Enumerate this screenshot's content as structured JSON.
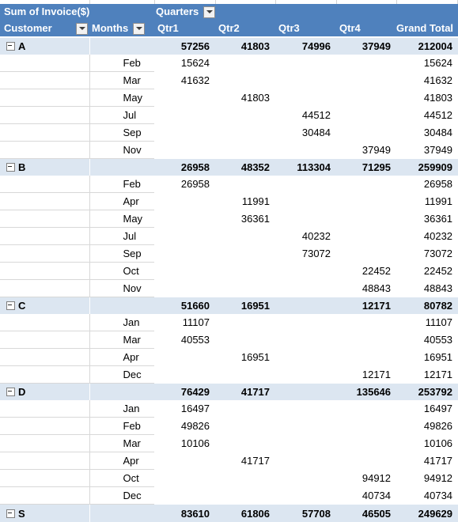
{
  "header": {
    "value_field_label": "Sum of Invoice($)",
    "column_field_label": "Quarters",
    "row_field_customer": "Customer",
    "row_field_months": "Months",
    "columns": [
      "Qtr1",
      "Qtr2",
      "Qtr3",
      "Qtr4",
      "Grand Total"
    ],
    "filter_icon": "chevron-down-icon"
  },
  "colors": {
    "header_blue": "#4f81bd",
    "subtotal_blue": "#dce6f1",
    "body_white": "#ffffff",
    "text_dark": "#000000",
    "header_text": "#ffffff"
  },
  "expand_icon": "minus-box-icon",
  "rows": [
    {
      "type": "subtotal",
      "customer": "A",
      "month": "",
      "qtr1": "57256",
      "qtr2": "41803",
      "qtr3": "74996",
      "qtr4": "37949",
      "total": "212004"
    },
    {
      "type": "data",
      "customer": "",
      "month": "Feb",
      "qtr1": "15624",
      "qtr2": "",
      "qtr3": "",
      "qtr4": "",
      "total": "15624"
    },
    {
      "type": "data",
      "customer": "",
      "month": "Mar",
      "qtr1": "41632",
      "qtr2": "",
      "qtr3": "",
      "qtr4": "",
      "total": "41632"
    },
    {
      "type": "data",
      "customer": "",
      "month": "May",
      "qtr1": "",
      "qtr2": "41803",
      "qtr3": "",
      "qtr4": "",
      "total": "41803"
    },
    {
      "type": "data",
      "customer": "",
      "month": "Jul",
      "qtr1": "",
      "qtr2": "",
      "qtr3": "44512",
      "qtr4": "",
      "total": "44512"
    },
    {
      "type": "data",
      "customer": "",
      "month": "Sep",
      "qtr1": "",
      "qtr2": "",
      "qtr3": "30484",
      "qtr4": "",
      "total": "30484"
    },
    {
      "type": "data",
      "customer": "",
      "month": "Nov",
      "qtr1": "",
      "qtr2": "",
      "qtr3": "",
      "qtr4": "37949",
      "total": "37949"
    },
    {
      "type": "subtotal",
      "customer": "B",
      "month": "",
      "qtr1": "26958",
      "qtr2": "48352",
      "qtr3": "113304",
      "qtr4": "71295",
      "total": "259909"
    },
    {
      "type": "data",
      "customer": "",
      "month": "Feb",
      "qtr1": "26958",
      "qtr2": "",
      "qtr3": "",
      "qtr4": "",
      "total": "26958"
    },
    {
      "type": "data",
      "customer": "",
      "month": "Apr",
      "qtr1": "",
      "qtr2": "11991",
      "qtr3": "",
      "qtr4": "",
      "total": "11991"
    },
    {
      "type": "data",
      "customer": "",
      "month": "May",
      "qtr1": "",
      "qtr2": "36361",
      "qtr3": "",
      "qtr4": "",
      "total": "36361"
    },
    {
      "type": "data",
      "customer": "",
      "month": "Jul",
      "qtr1": "",
      "qtr2": "",
      "qtr3": "40232",
      "qtr4": "",
      "total": "40232"
    },
    {
      "type": "data",
      "customer": "",
      "month": "Sep",
      "qtr1": "",
      "qtr2": "",
      "qtr3": "73072",
      "qtr4": "",
      "total": "73072"
    },
    {
      "type": "data",
      "customer": "",
      "month": "Oct",
      "qtr1": "",
      "qtr2": "",
      "qtr3": "",
      "qtr4": "22452",
      "total": "22452"
    },
    {
      "type": "data",
      "customer": "",
      "month": "Nov",
      "qtr1": "",
      "qtr2": "",
      "qtr3": "",
      "qtr4": "48843",
      "total": "48843"
    },
    {
      "type": "subtotal",
      "customer": "C",
      "month": "",
      "qtr1": "51660",
      "qtr2": "16951",
      "qtr3": "",
      "qtr4": "12171",
      "total": "80782"
    },
    {
      "type": "data",
      "customer": "",
      "month": "Jan",
      "qtr1": "11107",
      "qtr2": "",
      "qtr3": "",
      "qtr4": "",
      "total": "11107"
    },
    {
      "type": "data",
      "customer": "",
      "month": "Mar",
      "qtr1": "40553",
      "qtr2": "",
      "qtr3": "",
      "qtr4": "",
      "total": "40553"
    },
    {
      "type": "data",
      "customer": "",
      "month": "Apr",
      "qtr1": "",
      "qtr2": "16951",
      "qtr3": "",
      "qtr4": "",
      "total": "16951"
    },
    {
      "type": "data",
      "customer": "",
      "month": "Dec",
      "qtr1": "",
      "qtr2": "",
      "qtr3": "",
      "qtr4": "12171",
      "total": "12171"
    },
    {
      "type": "subtotal",
      "customer": "D",
      "month": "",
      "qtr1": "76429",
      "qtr2": "41717",
      "qtr3": "",
      "qtr4": "135646",
      "total": "253792"
    },
    {
      "type": "data",
      "customer": "",
      "month": "Jan",
      "qtr1": "16497",
      "qtr2": "",
      "qtr3": "",
      "qtr4": "",
      "total": "16497"
    },
    {
      "type": "data",
      "customer": "",
      "month": "Feb",
      "qtr1": "49826",
      "qtr2": "",
      "qtr3": "",
      "qtr4": "",
      "total": "49826"
    },
    {
      "type": "data",
      "customer": "",
      "month": "Mar",
      "qtr1": "10106",
      "qtr2": "",
      "qtr3": "",
      "qtr4": "",
      "total": "10106"
    },
    {
      "type": "data",
      "customer": "",
      "month": "Apr",
      "qtr1": "",
      "qtr2": "41717",
      "qtr3": "",
      "qtr4": "",
      "total": "41717"
    },
    {
      "type": "data",
      "customer": "",
      "month": "Oct",
      "qtr1": "",
      "qtr2": "",
      "qtr3": "",
      "qtr4": "94912",
      "total": "94912"
    },
    {
      "type": "data",
      "customer": "",
      "month": "Dec",
      "qtr1": "",
      "qtr2": "",
      "qtr3": "",
      "qtr4": "40734",
      "total": "40734"
    },
    {
      "type": "subtotal",
      "customer": "S",
      "month": "",
      "qtr1": "83610",
      "qtr2": "61806",
      "qtr3": "57708",
      "qtr4": "46505",
      "total": "249629"
    }
  ]
}
